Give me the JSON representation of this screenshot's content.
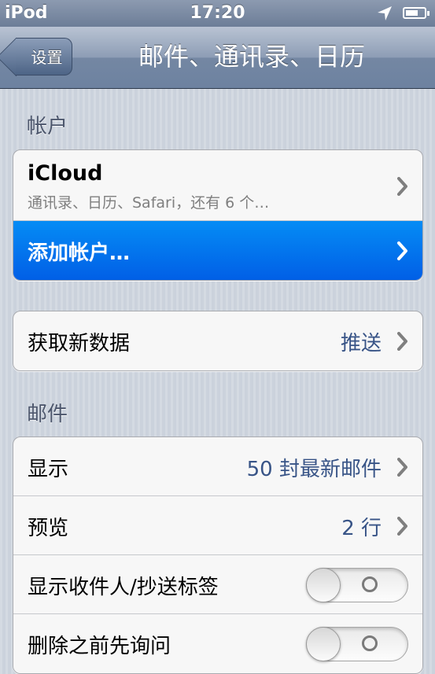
{
  "status_bar": {
    "carrier": "iPod",
    "time": "17:20",
    "location_icon": "location-arrow-icon",
    "battery_icon": "battery-icon"
  },
  "nav": {
    "back_label": "设置",
    "title": "邮件、通讯录、日历"
  },
  "accounts": {
    "header": "帐户",
    "icloud": {
      "title": "iCloud",
      "subtitle": "通讯录、日历、Safari，还有 6 个…"
    },
    "add_account": "添加帐户…"
  },
  "fetch": {
    "label": "获取新数据",
    "value": "推送"
  },
  "mail": {
    "header": "邮件",
    "rows": [
      {
        "label": "显示",
        "value": "50 封最新邮件"
      },
      {
        "label": "预览",
        "value": "2 行"
      }
    ],
    "toggles": [
      {
        "label": "显示收件人/抄送标签",
        "state": "off"
      },
      {
        "label": "删除之前先询问",
        "state": "off"
      }
    ]
  },
  "colors": {
    "selected_row": "#0274ee",
    "value_text": "#385487",
    "nav_bar": "#7d8fab"
  }
}
